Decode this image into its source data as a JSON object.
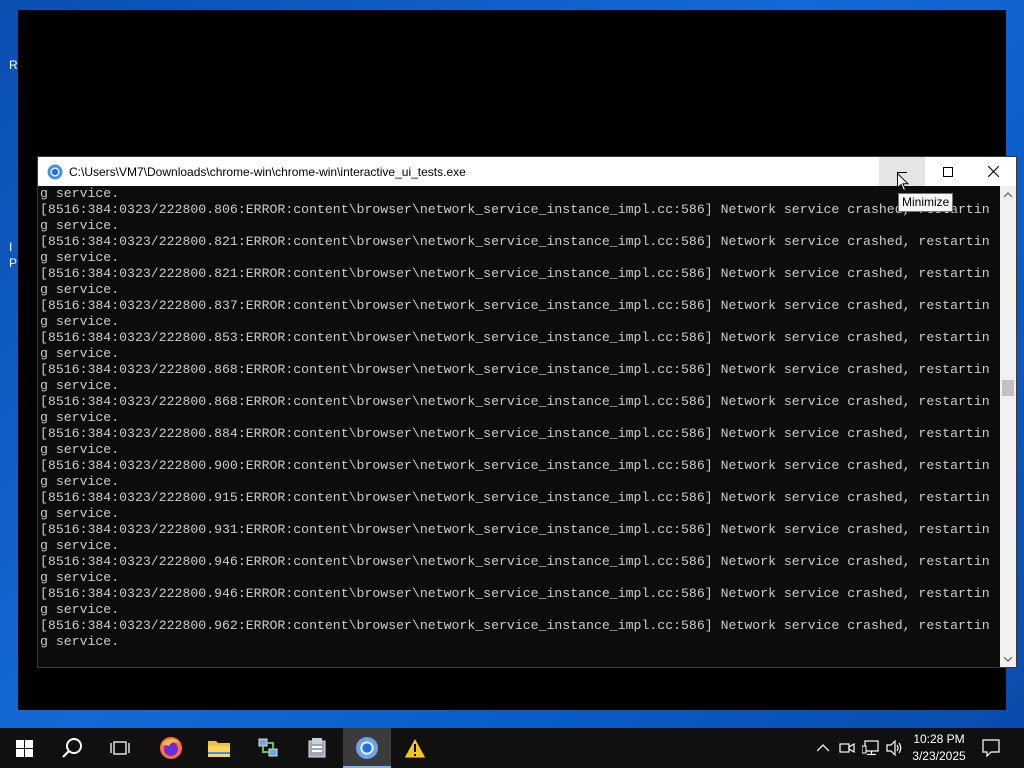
{
  "desktop": {
    "fragments": [
      "R",
      "I",
      "P"
    ]
  },
  "console": {
    "title": "C:\\Users\\VM7\\Downloads\\chrome-win\\chrome-win\\interactive_ui_tests.exe",
    "lines": [
      "g service.",
      "[8516:384:0323/222800.806:ERROR:content\\browser\\network_service_instance_impl.cc:586] Network service crashed, restartin",
      "g service.",
      "[8516:384:0323/222800.821:ERROR:content\\browser\\network_service_instance_impl.cc:586] Network service crashed, restartin",
      "g service.",
      "[8516:384:0323/222800.821:ERROR:content\\browser\\network_service_instance_impl.cc:586] Network service crashed, restartin",
      "g service.",
      "[8516:384:0323/222800.837:ERROR:content\\browser\\network_service_instance_impl.cc:586] Network service crashed, restartin",
      "g service.",
      "[8516:384:0323/222800.853:ERROR:content\\browser\\network_service_instance_impl.cc:586] Network service crashed, restartin",
      "g service.",
      "[8516:384:0323/222800.868:ERROR:content\\browser\\network_service_instance_impl.cc:586] Network service crashed, restartin",
      "g service.",
      "[8516:384:0323/222800.868:ERROR:content\\browser\\network_service_instance_impl.cc:586] Network service crashed, restartin",
      "g service.",
      "[8516:384:0323/222800.884:ERROR:content\\browser\\network_service_instance_impl.cc:586] Network service crashed, restartin",
      "g service.",
      "[8516:384:0323/222800.900:ERROR:content\\browser\\network_service_instance_impl.cc:586] Network service crashed, restartin",
      "g service.",
      "[8516:384:0323/222800.915:ERROR:content\\browser\\network_service_instance_impl.cc:586] Network service crashed, restartin",
      "g service.",
      "[8516:384:0323/222800.931:ERROR:content\\browser\\network_service_instance_impl.cc:586] Network service crashed, restartin",
      "g service.",
      "[8516:384:0323/222800.946:ERROR:content\\browser\\network_service_instance_impl.cc:586] Network service crashed, restartin",
      "g service.",
      "[8516:384:0323/222800.946:ERROR:content\\browser\\network_service_instance_impl.cc:586] Network service crashed, restartin",
      "g service.",
      "[8516:384:0323/222800.962:ERROR:content\\browser\\network_service_instance_impl.cc:586] Network service crashed, restartin",
      "g service."
    ]
  },
  "tooltip": {
    "text": "Minimize"
  },
  "taskbar": {
    "items": [
      {
        "name": "start-button",
        "icon": "windows-logo-icon"
      },
      {
        "name": "search-button",
        "icon": "search-icon"
      },
      {
        "name": "task-view-button",
        "icon": "task-view-icon"
      },
      {
        "name": "firefox-button",
        "icon": "firefox-icon"
      },
      {
        "name": "file-explorer-button",
        "icon": "folder-icon"
      },
      {
        "name": "network-tool-button",
        "icon": "network-app-icon"
      },
      {
        "name": "app-button",
        "icon": "app-icon"
      },
      {
        "name": "chromium-button",
        "icon": "chromium-icon",
        "active": true
      },
      {
        "name": "warning-app-button",
        "icon": "warning-icon"
      }
    ],
    "clock": {
      "time": "10:28 PM",
      "date": "3/23/2025"
    }
  },
  "colors": {
    "desktop_bg": "#1569d6",
    "console_bg": "#0c0c0c",
    "console_text": "#cccccc",
    "taskbar_bg": "#101010",
    "active_indicator": "#7ab4f5"
  }
}
